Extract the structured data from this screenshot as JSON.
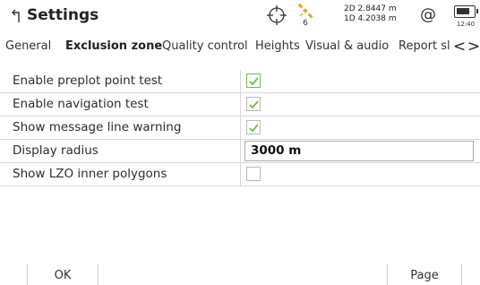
{
  "header": {
    "title": "Settings",
    "satellite_count": "6",
    "precision_2d": "2D 2.8447 m",
    "precision_1d": "1D 4.2038 m",
    "at_symbol": "@",
    "time": "12:40"
  },
  "tabs": [
    {
      "label": "General",
      "active": false
    },
    {
      "label": "Exclusion zone",
      "active": true
    },
    {
      "label": "Quality control",
      "active": false
    },
    {
      "label": "Heights",
      "active": false
    },
    {
      "label": "Visual & audio",
      "active": false
    },
    {
      "label": "Report sl",
      "active": false
    }
  ],
  "tab_nav": {
    "prev": "<",
    "next": ">"
  },
  "settings": [
    {
      "label": "Enable preplot point test",
      "type": "checkbox",
      "checked": true,
      "focused": true
    },
    {
      "label": "Enable navigation test",
      "type": "checkbox",
      "checked": true,
      "focused": false
    },
    {
      "label": "Show message line warning",
      "type": "checkbox",
      "checked": true,
      "focused": false
    },
    {
      "label": "Display radius",
      "type": "text",
      "value": "3000 m"
    },
    {
      "label": "Show LZO inner polygons",
      "type": "checkbox",
      "checked": false,
      "focused": false
    }
  ],
  "softkeys": {
    "ok": "OK",
    "page": "Page"
  },
  "colors": {
    "check": "#7ab648",
    "satellite": "#f29a2e"
  }
}
